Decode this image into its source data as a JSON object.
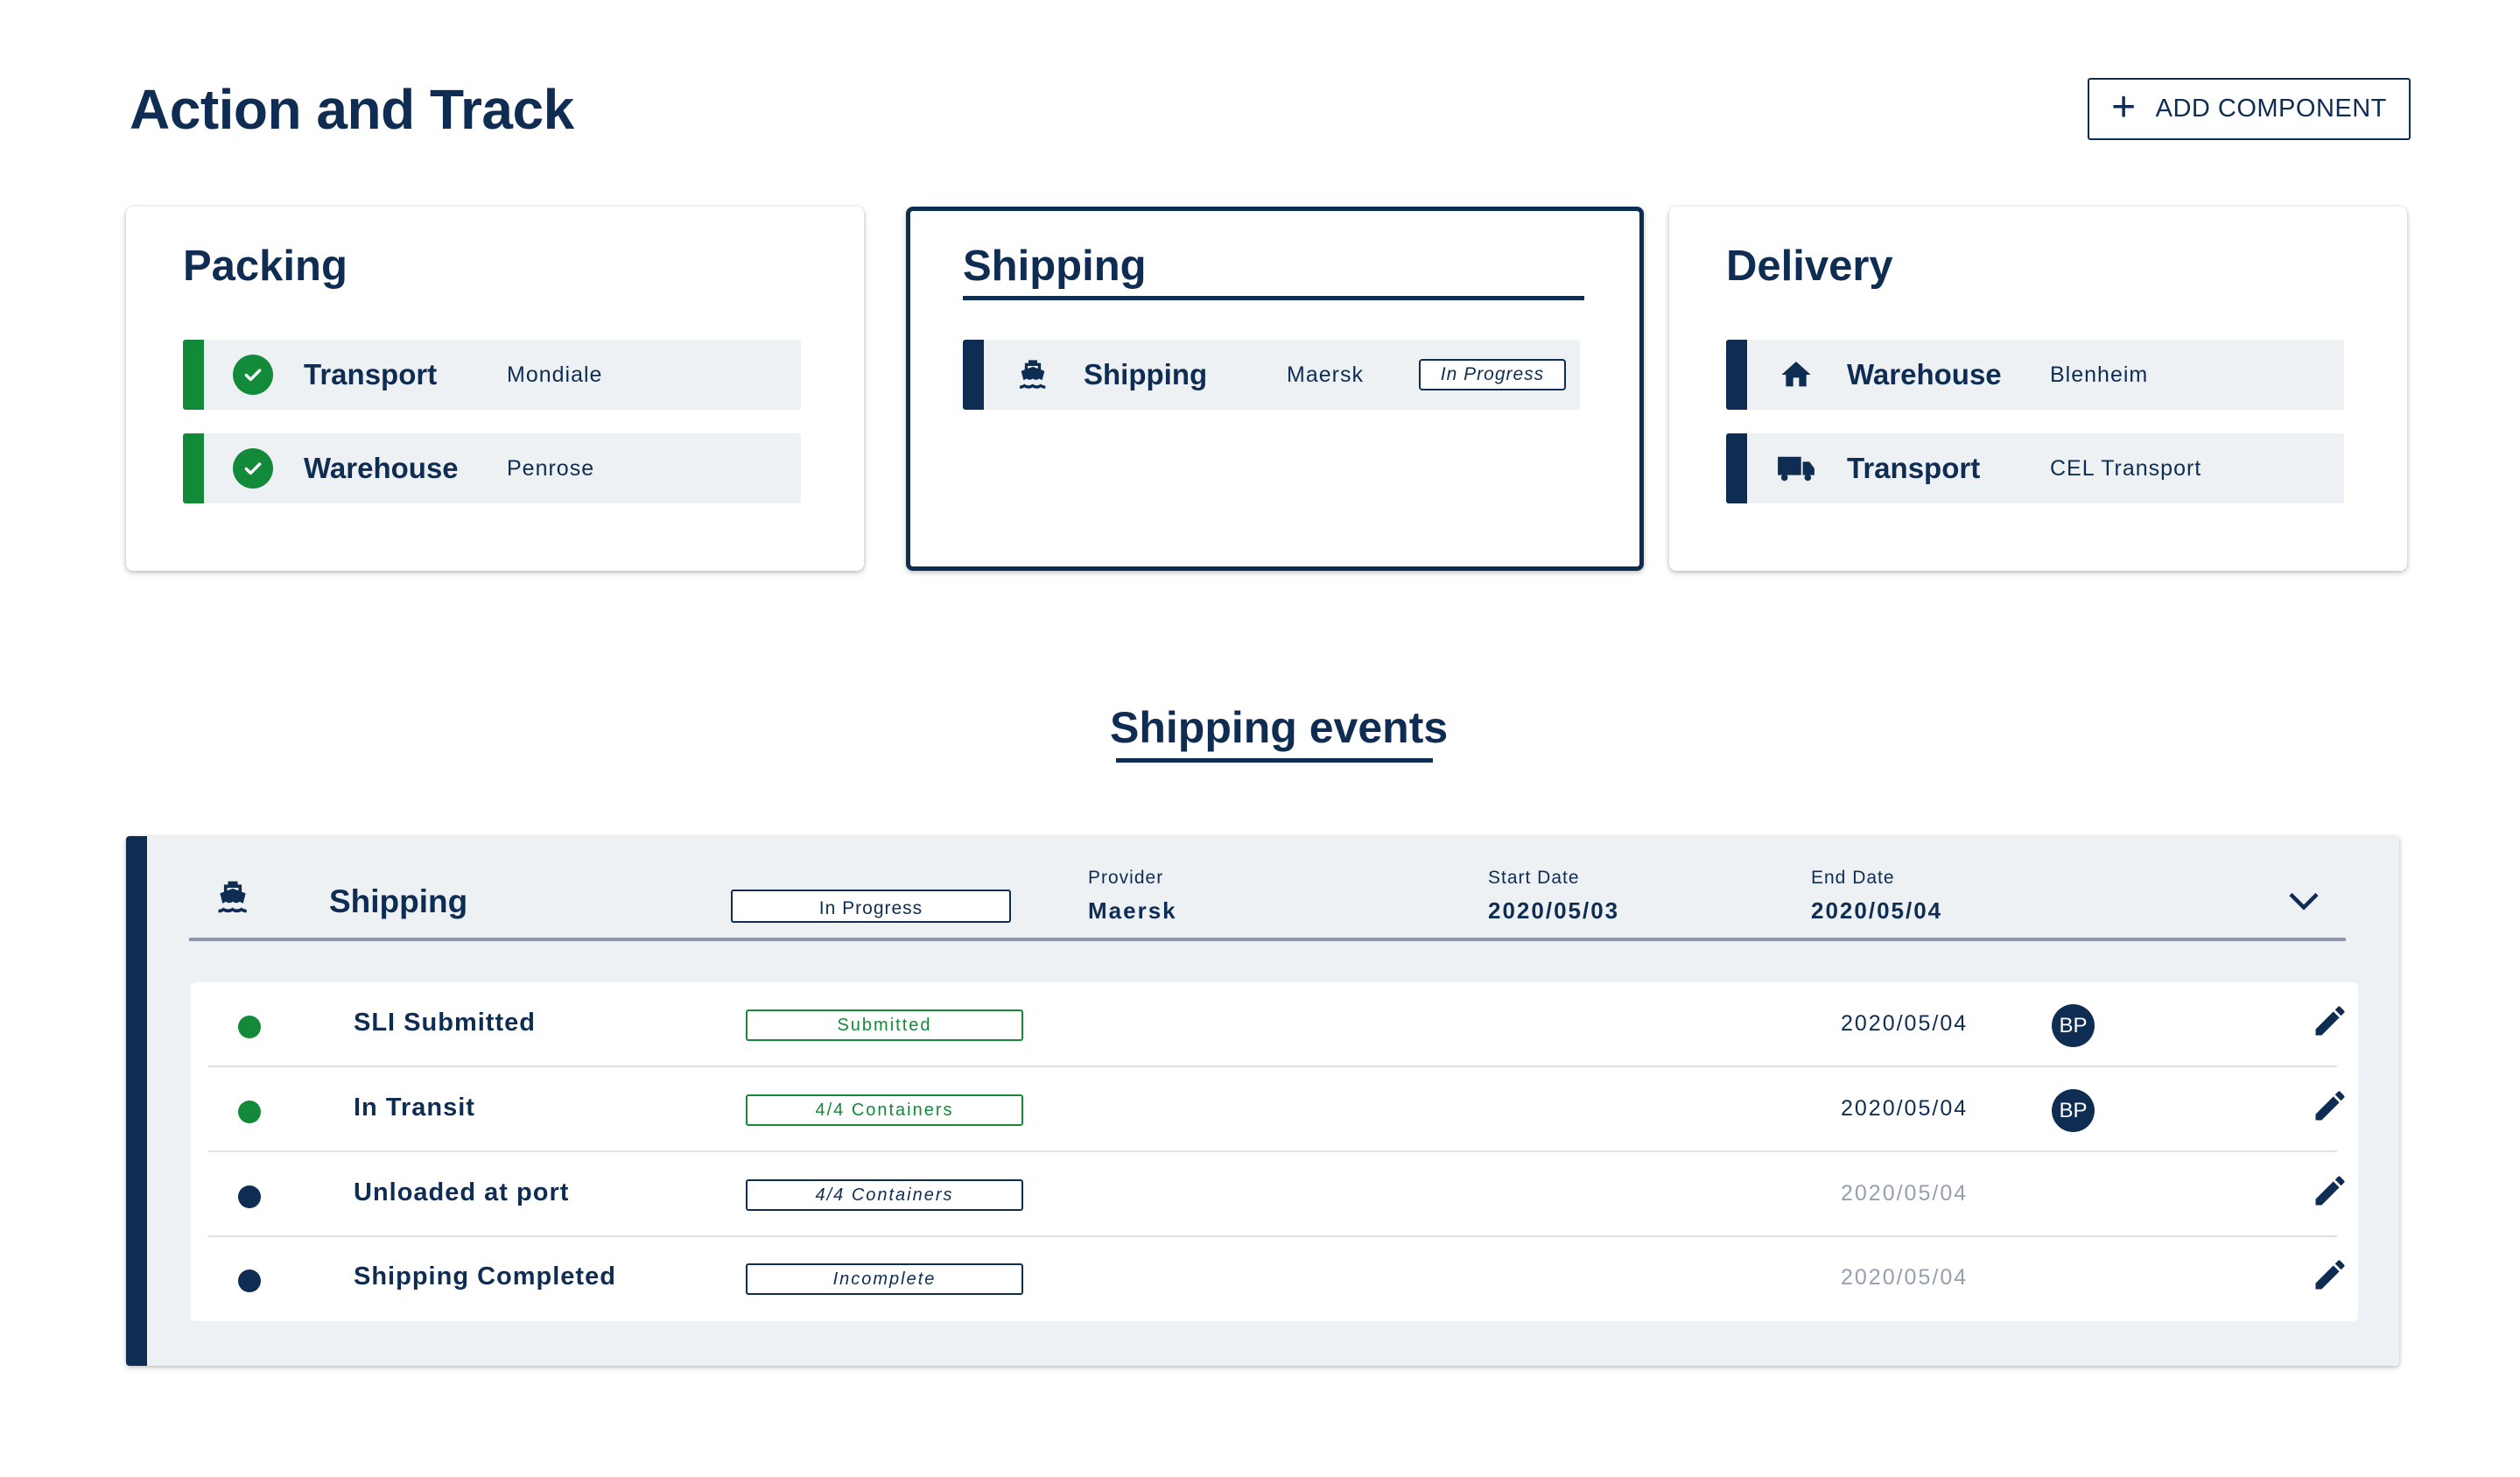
{
  "header": {
    "title": "Action and Track",
    "add_button_icon": "plus-icon",
    "add_button_label": "ADD COMPONENT"
  },
  "colors": {
    "navy": "#0f2d52",
    "green": "#138a3a",
    "row_bg": "#edf1f4",
    "muted": "#96a0b0"
  },
  "cards": {
    "packing": {
      "title": "Packing",
      "items": [
        {
          "icon": "check-circle-icon",
          "label": "Transport",
          "provider": "Mondiale"
        },
        {
          "icon": "check-circle-icon",
          "label": "Warehouse",
          "provider": "Penrose"
        }
      ]
    },
    "shipping": {
      "title": "Shipping",
      "items": [
        {
          "icon": "ship-icon",
          "label": "Shipping",
          "provider": "Maersk",
          "status": "In Progress"
        }
      ]
    },
    "delivery": {
      "title": "Delivery",
      "items": [
        {
          "icon": "home-icon",
          "label": "Warehouse",
          "provider": "Blenheim"
        },
        {
          "icon": "truck-icon",
          "label": "Transport",
          "provider": "CEL Transport"
        }
      ]
    }
  },
  "events_section": {
    "title": "Shipping events",
    "panel": {
      "icon": "ship-icon",
      "title": "Shipping",
      "status": "In Progress",
      "provider_label": "Provider",
      "provider": "Maersk",
      "start_label": "Start Date",
      "start": "2020/05/03",
      "end_label": "End Date",
      "end": "2020/05/04",
      "expand_icon": "chevron-down-icon"
    },
    "events": [
      {
        "name": "SLI Submitted",
        "tag": "Submitted",
        "date": "2020/05/04",
        "avatar": "BP",
        "edit_icon": "pencil-icon"
      },
      {
        "name": "In Transit",
        "tag": "4/4 Containers",
        "date": "2020/05/04",
        "avatar": "BP",
        "edit_icon": "pencil-icon"
      },
      {
        "name": "Unloaded at port",
        "tag": "4/4 Containers",
        "date": "2020/05/04",
        "edit_icon": "pencil-icon"
      },
      {
        "name": "Shipping Completed",
        "tag": "Incomplete",
        "date": "2020/05/04",
        "edit_icon": "pencil-icon"
      }
    ]
  }
}
